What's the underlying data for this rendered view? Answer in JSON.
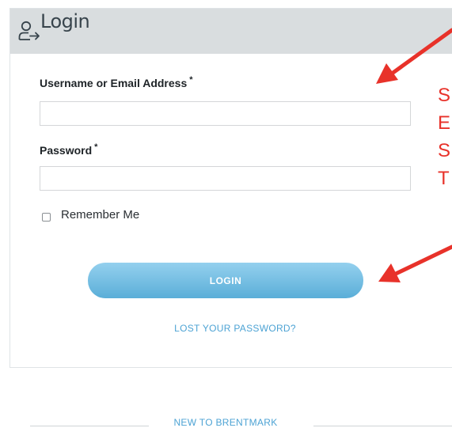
{
  "login_card": {
    "title": "Login",
    "title_icon": "user-arrow-icon",
    "username_label": "Username or Email Address",
    "password_label": "Password",
    "required_mark": "*",
    "username_value": "",
    "password_value": "",
    "remember_label": "Remember Me",
    "remember_checked": false,
    "login_button": "LOGIN",
    "lost_password": "LOST YOUR PASSWORD?"
  },
  "annotation_letters": [
    "S",
    "E",
    "S",
    "T"
  ],
  "footer": {
    "new_to": "NEW TO BRENTMARK"
  },
  "colors": {
    "header_bg": "#d9dddf",
    "button_top": "#94d0ee",
    "button_bottom": "#5aaed8",
    "link": "#4da3d4",
    "annotation_red": "#e8322a"
  }
}
